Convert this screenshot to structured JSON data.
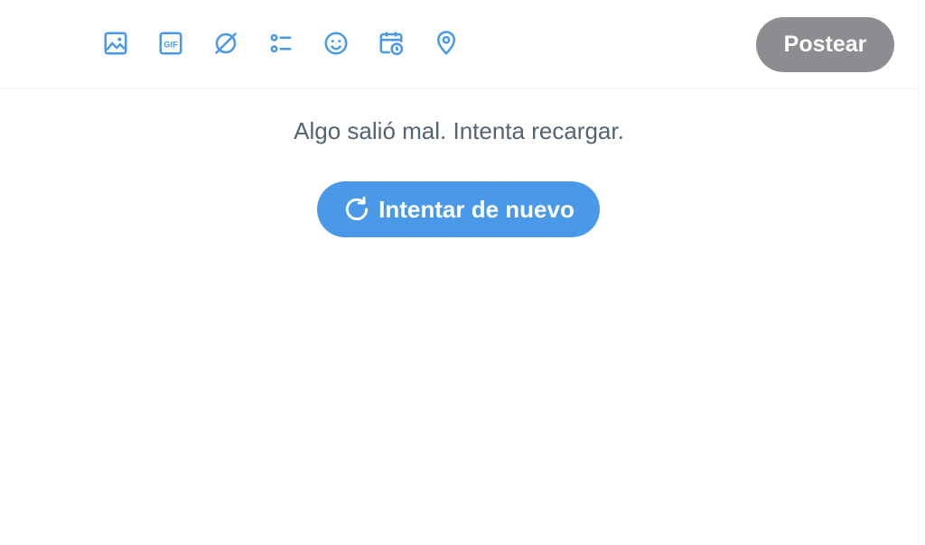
{
  "colors": {
    "accent": "#4a99e9",
    "icon": "#4a99e9",
    "post_button_disabled": "#8b8d90",
    "text_secondary": "#536471",
    "divider": "#eff3f4"
  },
  "toolbar": {
    "icons": [
      {
        "name": "image-icon"
      },
      {
        "name": "gif-icon",
        "glyph": "GIF"
      },
      {
        "name": "grok-icon"
      },
      {
        "name": "poll-icon"
      },
      {
        "name": "emoji-icon"
      },
      {
        "name": "schedule-icon"
      },
      {
        "name": "location-icon"
      }
    ],
    "post_label": "Postear"
  },
  "error": {
    "message": "Algo salió mal. Intenta recargar.",
    "retry_label": "Intentar de nuevo",
    "retry_icon": "refresh-icon"
  }
}
